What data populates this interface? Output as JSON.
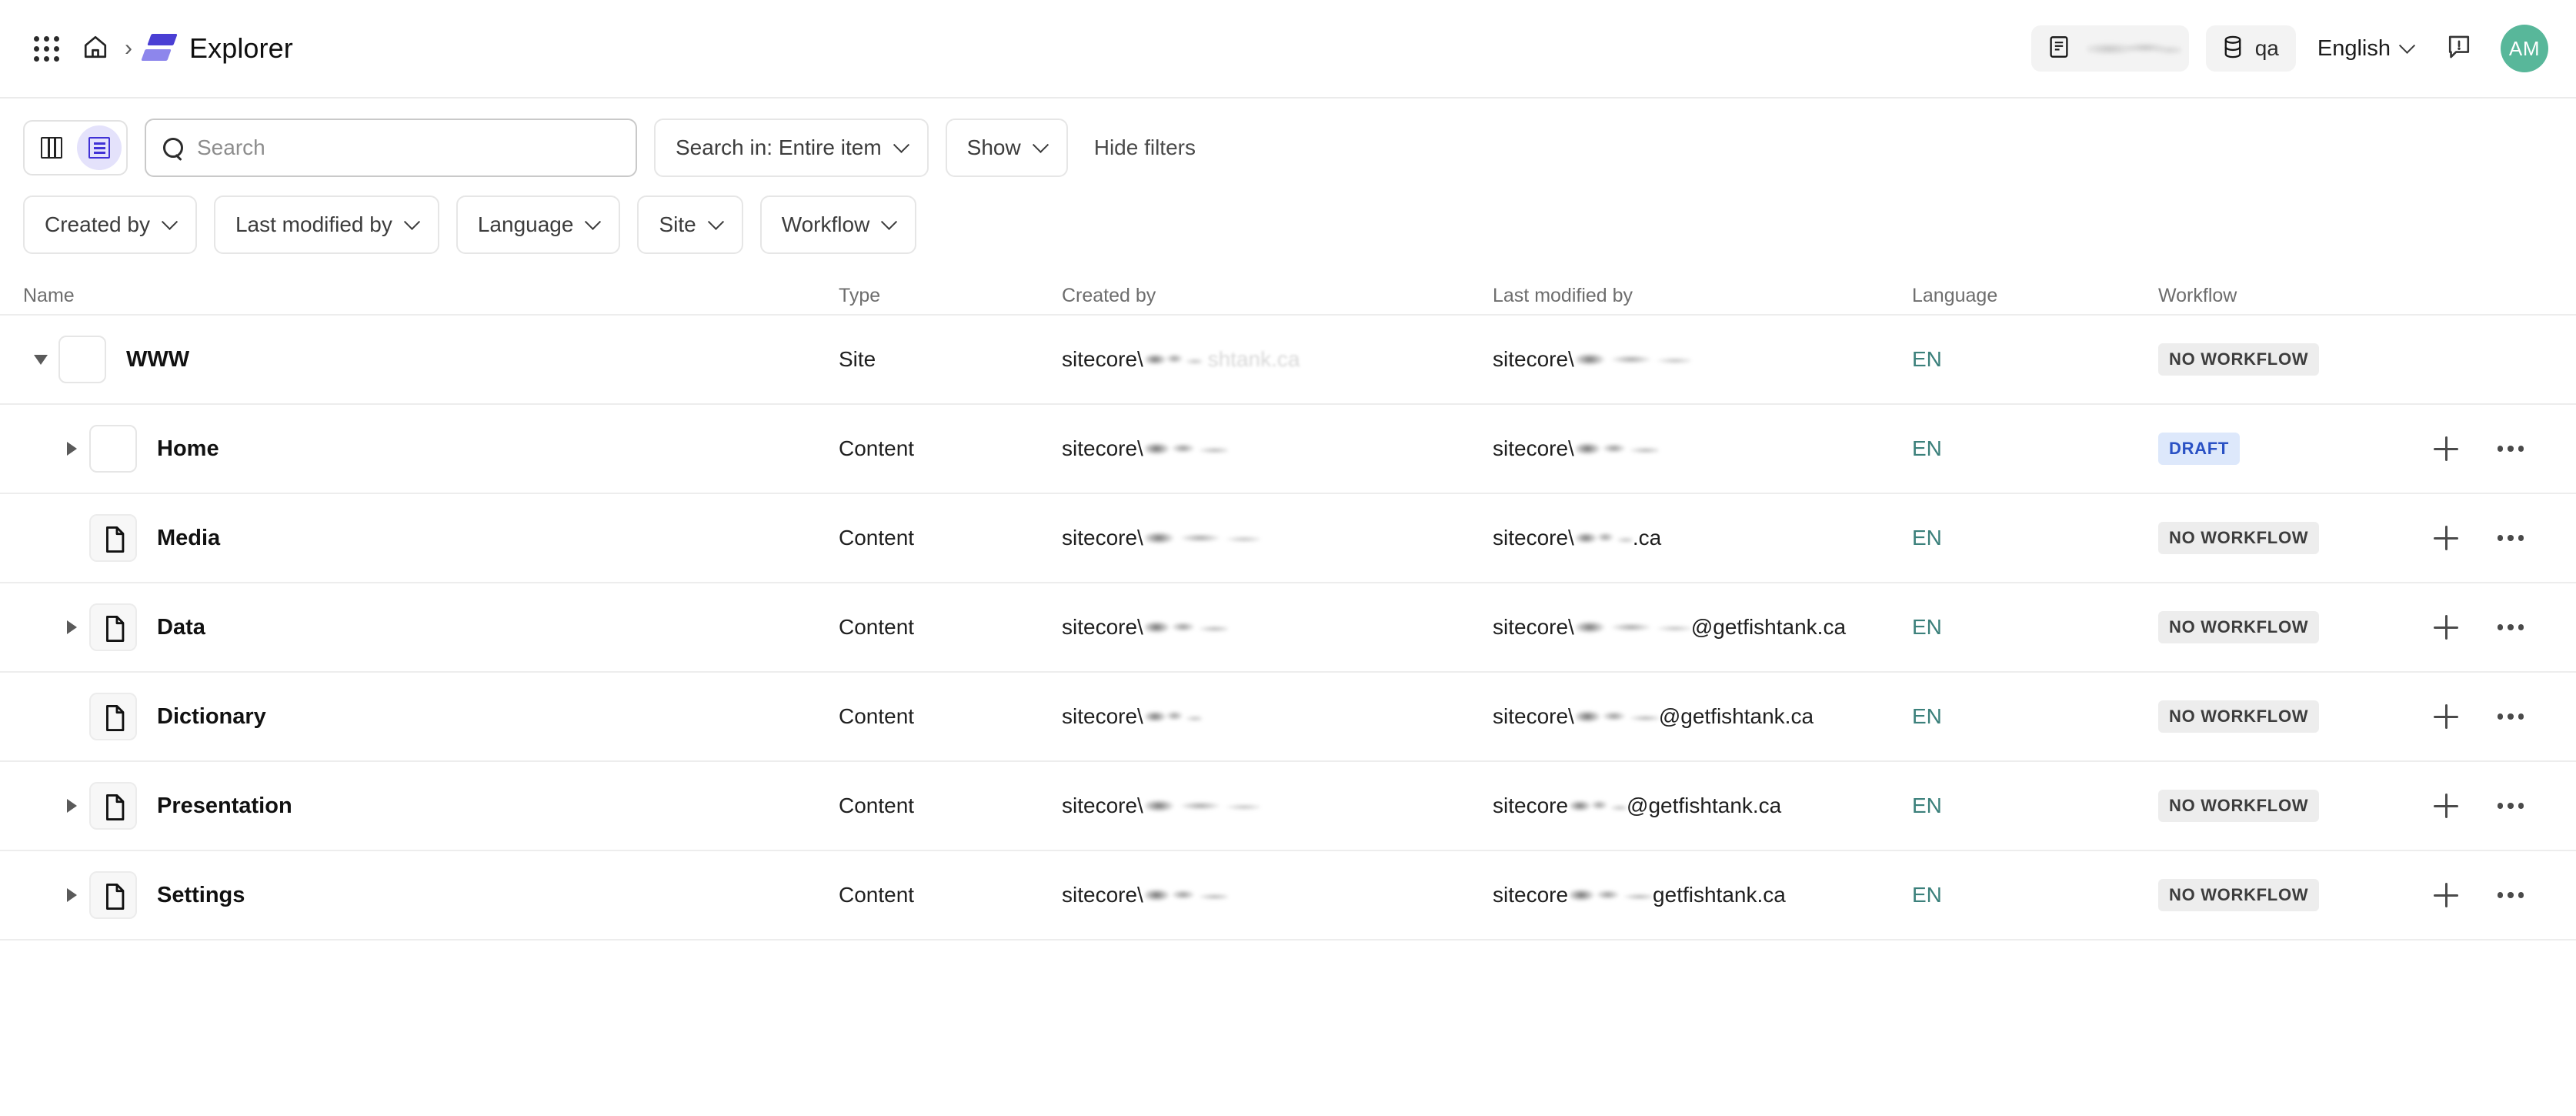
{
  "header": {
    "apps_label": "Apps",
    "home_label": "Home",
    "breadcrumb_separator": "›",
    "app_title": "Explorer",
    "site_chip": {
      "label": "",
      "redacted": true
    },
    "db_chip": {
      "label": "qa"
    },
    "language_selector": {
      "label": "English"
    },
    "feedback_label": "Feedback",
    "avatar": {
      "initials": "AM",
      "color": "#58b79a"
    }
  },
  "toolbar": {
    "view_toggle": {
      "columns_label": "Columns view",
      "list_label": "List view",
      "active": "list"
    },
    "search": {
      "value": "",
      "placeholder": "Search"
    },
    "search_in": {
      "label": "Search in: Entire item"
    },
    "show": {
      "label": "Show"
    },
    "hide_filters": {
      "label": "Hide filters"
    }
  },
  "filters": [
    {
      "label": "Created by"
    },
    {
      "label": "Last modified by"
    },
    {
      "label": "Language"
    },
    {
      "label": "Site"
    },
    {
      "label": "Workflow"
    }
  ],
  "table": {
    "columns": [
      "Name",
      "Type",
      "Created by",
      "Last modified by",
      "Language",
      "Workflow"
    ],
    "rows": [
      {
        "name": "WWW",
        "type": "Site",
        "indent": 0,
        "twisty": "down",
        "icon": "blank",
        "created_by_prefix": "sitecore\\",
        "created_by_suffix": "shtank.ca",
        "modified_by_prefix": "sitecore\\",
        "modified_by_suffix": "",
        "language": "EN",
        "workflow": "NO WORKFLOW",
        "workflow_style": "none",
        "actions": false
      },
      {
        "name": "Home",
        "type": "Content",
        "indent": 1,
        "twisty": "right",
        "icon": "blank",
        "created_by_prefix": "sitecore\\",
        "created_by_suffix": "",
        "modified_by_prefix": "sitecore\\",
        "modified_by_suffix": "",
        "language": "EN",
        "workflow": "DRAFT",
        "workflow_style": "draft",
        "actions": true
      },
      {
        "name": "Media",
        "type": "Content",
        "indent": 1,
        "twisty": "none",
        "icon": "document",
        "created_by_prefix": "sitecore\\",
        "created_by_suffix": "",
        "modified_by_prefix": "sitecore\\",
        "modified_by_suffix": ".ca",
        "language": "EN",
        "workflow": "NO WORKFLOW",
        "workflow_style": "none",
        "actions": true
      },
      {
        "name": "Data",
        "type": "Content",
        "indent": 1,
        "twisty": "right",
        "icon": "document",
        "created_by_prefix": "sitecore\\",
        "created_by_suffix": "",
        "modified_by_prefix": "sitecore\\",
        "modified_by_suffix": "@getfishtank.ca",
        "language": "EN",
        "workflow": "NO WORKFLOW",
        "workflow_style": "none",
        "actions": true
      },
      {
        "name": "Dictionary",
        "type": "Content",
        "indent": 1,
        "twisty": "none",
        "icon": "document",
        "created_by_prefix": "sitecore\\",
        "created_by_suffix": "",
        "modified_by_prefix": "sitecore\\",
        "modified_by_suffix": "@getfishtank.ca",
        "language": "EN",
        "workflow": "NO WORKFLOW",
        "workflow_style": "none",
        "actions": true
      },
      {
        "name": "Presentation",
        "type": "Content",
        "indent": 1,
        "twisty": "right",
        "icon": "document",
        "created_by_prefix": "sitecore\\",
        "created_by_suffix": "",
        "modified_by_prefix": "sitecore",
        "modified_by_suffix": "@getfishtank.ca",
        "language": "EN",
        "workflow": "NO WORKFLOW",
        "workflow_style": "none",
        "actions": true
      },
      {
        "name": "Settings",
        "type": "Content",
        "indent": 1,
        "twisty": "right",
        "icon": "document",
        "created_by_prefix": "sitecore\\",
        "created_by_suffix": "",
        "modified_by_prefix": "sitecore",
        "modified_by_suffix": "getfishtank.ca",
        "language": "EN",
        "workflow": "NO WORKFLOW",
        "workflow_style": "none",
        "actions": true
      }
    ]
  }
}
